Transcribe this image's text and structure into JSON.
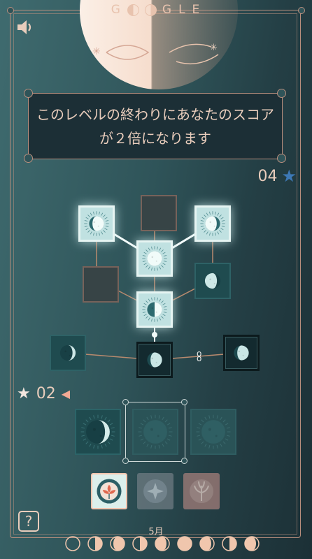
{
  "title": {
    "letters": [
      "G",
      "G",
      "L",
      "E"
    ]
  },
  "message": "このレベルの終わりにあなたのスコアが２倍になります",
  "score_top": {
    "value": "04",
    "star": "★"
  },
  "level": {
    "star": "★",
    "value": "02",
    "arrow": "◀"
  },
  "help_label": "?",
  "month_label": "5月",
  "colors": {
    "accent": "#b98f7e",
    "text": "#e9cdbc",
    "star_blue": "#3d78b5",
    "moon": "#f6e0cf"
  },
  "icons": {
    "sound": "speaker-icon",
    "help": "question-icon",
    "chain": "chain-link-icon"
  },
  "board": {
    "tiles": [
      {
        "name": "tile-waxing-gibbous-lit",
        "phase": "waxing-gibbous",
        "style": "light"
      },
      {
        "name": "tile-empty-top",
        "phase": "empty",
        "style": "empty"
      },
      {
        "name": "tile-waning-gibbous-lit",
        "phase": "waning-gibbous",
        "style": "light"
      },
      {
        "name": "tile-full-moon-lit",
        "phase": "full",
        "style": "light"
      },
      {
        "name": "tile-empty-left",
        "phase": "empty",
        "style": "empty"
      },
      {
        "name": "tile-waning-gibbous-dark",
        "phase": "waning-gibbous",
        "style": "dark"
      },
      {
        "name": "tile-first-quarter-lit",
        "phase": "first-quarter",
        "style": "light"
      },
      {
        "name": "tile-waxing-crescent-dark",
        "phase": "waxing-crescent",
        "style": "dark"
      },
      {
        "name": "tile-gibbous-black-center",
        "phase": "waxing-gibbous",
        "style": "black"
      },
      {
        "name": "tile-gibbous-black-right",
        "phase": "waxing-gibbous",
        "style": "black"
      }
    ]
  },
  "hand": [
    {
      "name": "hand-tile-crescent",
      "phase": "waxing-crescent"
    },
    {
      "name": "hand-tile-new-selected",
      "phase": "new"
    },
    {
      "name": "hand-tile-new",
      "phase": "new"
    }
  ],
  "power_ups": [
    "flower-icon",
    "star-icon",
    "plant-icon"
  ],
  "phase_track": [
    "new",
    "first-quarter",
    "waxing-gibbous",
    "first-quarter",
    "waning-gibbous",
    "full",
    "waning-gibbous",
    "first-quarter",
    "waning-gibbous"
  ]
}
